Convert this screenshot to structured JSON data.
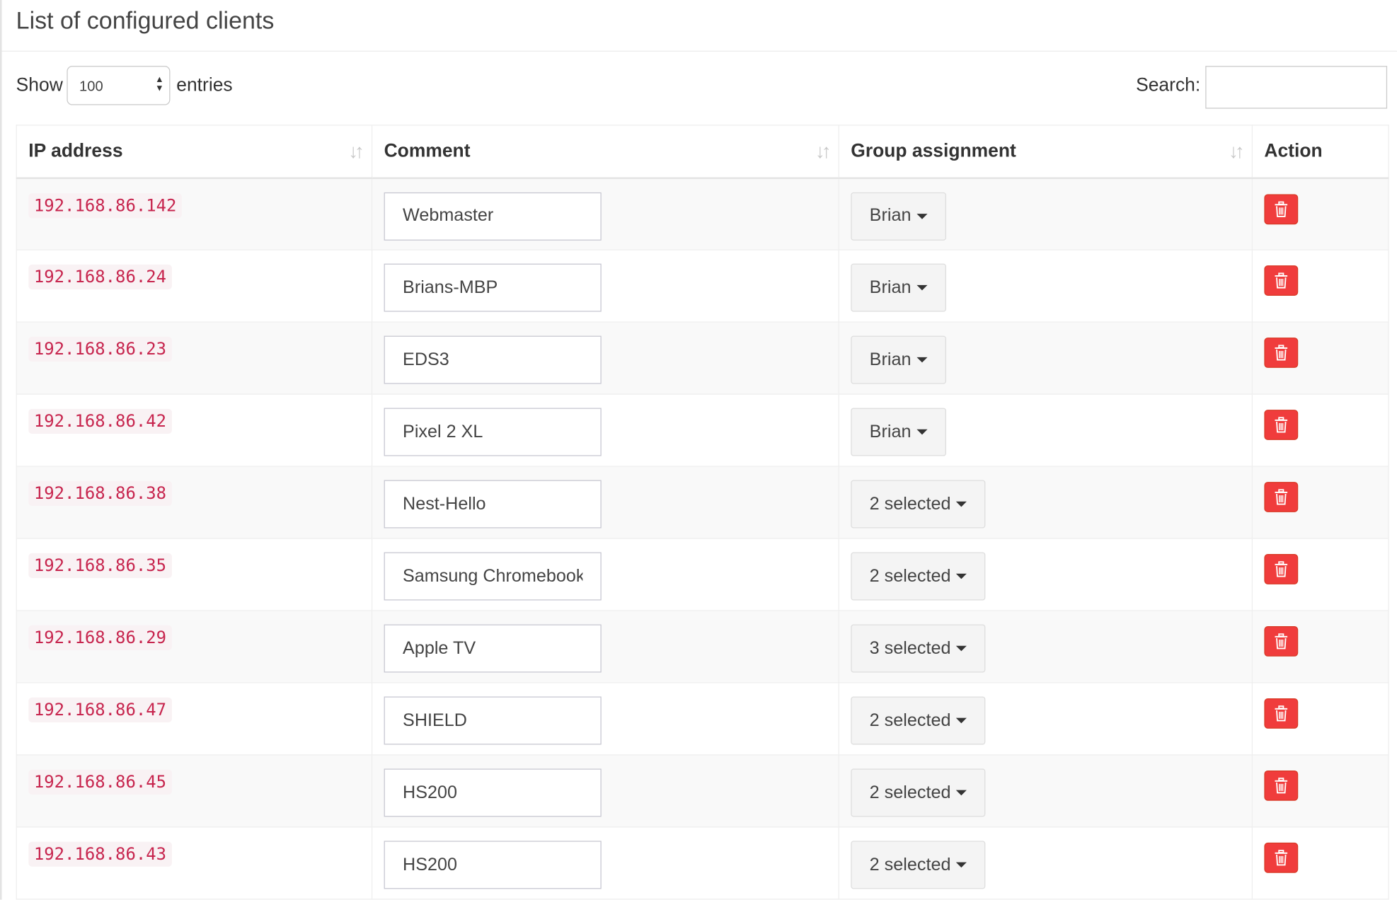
{
  "box": {
    "title": "List of configured clients"
  },
  "controls": {
    "show_label": "Show",
    "page_length": "100",
    "entries_label": "entries",
    "search_label": "Search:",
    "search_value": ""
  },
  "table": {
    "columns": [
      "IP address",
      "Comment",
      "Group assignment",
      "Action"
    ],
    "rows": [
      {
        "ip": "192.168.86.142",
        "comment": "Webmaster",
        "group": "Brian"
      },
      {
        "ip": "192.168.86.24",
        "comment": "Brians-MBP",
        "group": "Brian"
      },
      {
        "ip": "192.168.86.23",
        "comment": "EDS3",
        "group": "Brian"
      },
      {
        "ip": "192.168.86.42",
        "comment": "Pixel 2 XL",
        "group": "Brian"
      },
      {
        "ip": "192.168.86.38",
        "comment": "Nest-Hello",
        "group": "2 selected"
      },
      {
        "ip": "192.168.86.35",
        "comment": "Samsung Chromebook",
        "group": "2 selected"
      },
      {
        "ip": "192.168.86.29",
        "comment": "Apple TV",
        "group": "3 selected"
      },
      {
        "ip": "192.168.86.47",
        "comment": "SHIELD",
        "group": "2 selected"
      },
      {
        "ip": "192.168.86.45",
        "comment": "HS200",
        "group": "2 selected"
      },
      {
        "ip": "192.168.86.43",
        "comment": "HS200",
        "group": "2 selected"
      }
    ]
  },
  "icons": {
    "sort": "sort-icon",
    "delete": "trash-icon",
    "dropdown": "caret-down-icon"
  },
  "colors": {
    "ip_text": "#c7254e",
    "ip_bg": "#f9f2f4",
    "delete_button": "#f03c3c"
  }
}
